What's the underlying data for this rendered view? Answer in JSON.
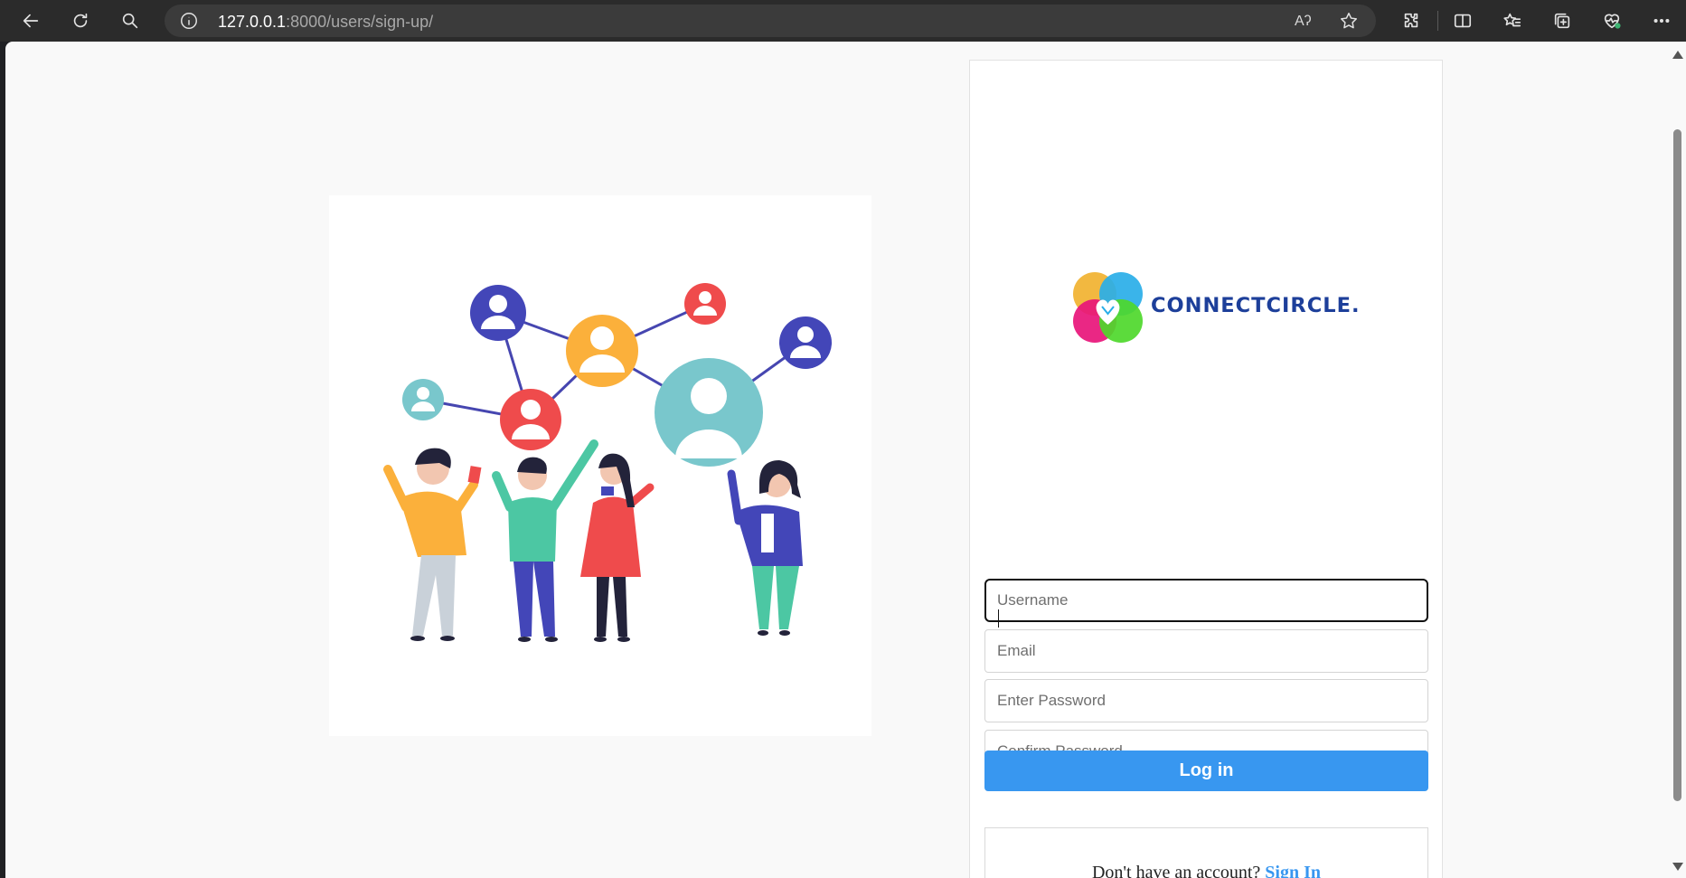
{
  "browser": {
    "url_host": "127.0.0.1",
    "url_rest": ":8000/users/sign-up/",
    "read_aloud_label": "Aʔ"
  },
  "brand": {
    "name": "CONNECTCIRCLE."
  },
  "form": {
    "username_placeholder": "Username",
    "email_placeholder": "Email",
    "password_placeholder": "Enter Password",
    "confirm_placeholder": "Confirm Password",
    "submit_label": "Log in"
  },
  "footer": {
    "prompt": "Don't have an account? ",
    "link_label": "Sign In"
  },
  "colors": {
    "accent": "#3897f0",
    "brand_text": "#1d3f9a",
    "toolbar_bg": "#2b2b2b"
  }
}
